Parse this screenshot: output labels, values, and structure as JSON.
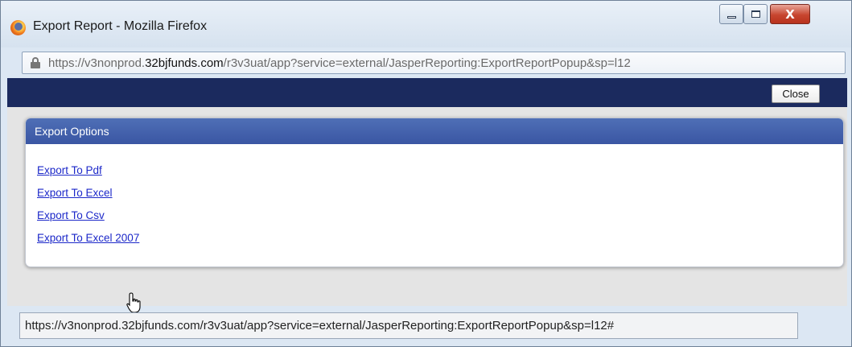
{
  "window": {
    "title": "Export Report - Mozilla Firefox",
    "controls": {
      "minimize": "",
      "maximize": "",
      "close": "X"
    }
  },
  "urlbar": {
    "prefix": "https://v3nonprod.",
    "host": "32bjfunds.com",
    "path": "/r3v3uat/app?service=external/JasperReporting:ExportReportPopup&sp=l12"
  },
  "toolbar": {
    "close_label": "Close"
  },
  "panel": {
    "title": "Export Options",
    "links": [
      {
        "label": "Export To Pdf"
      },
      {
        "label": "Export To Excel"
      },
      {
        "label": "Export To Csv"
      },
      {
        "label": "Export To Excel 2007"
      }
    ]
  },
  "statusbar": {
    "text": "https://v3nonprod.32bjfunds.com/r3v3uat/app?service=external/JasperReporting:ExportReportPopup&sp=l12#"
  },
  "icons": {
    "app": "firefox-icon",
    "lock": "lock-icon",
    "cursor": "hand-pointer-icon"
  },
  "colors": {
    "navbar": "#1b2a5e",
    "panel_header": "#3a56a3",
    "link": "#1c28c9",
    "close_control": "#c7452f"
  }
}
